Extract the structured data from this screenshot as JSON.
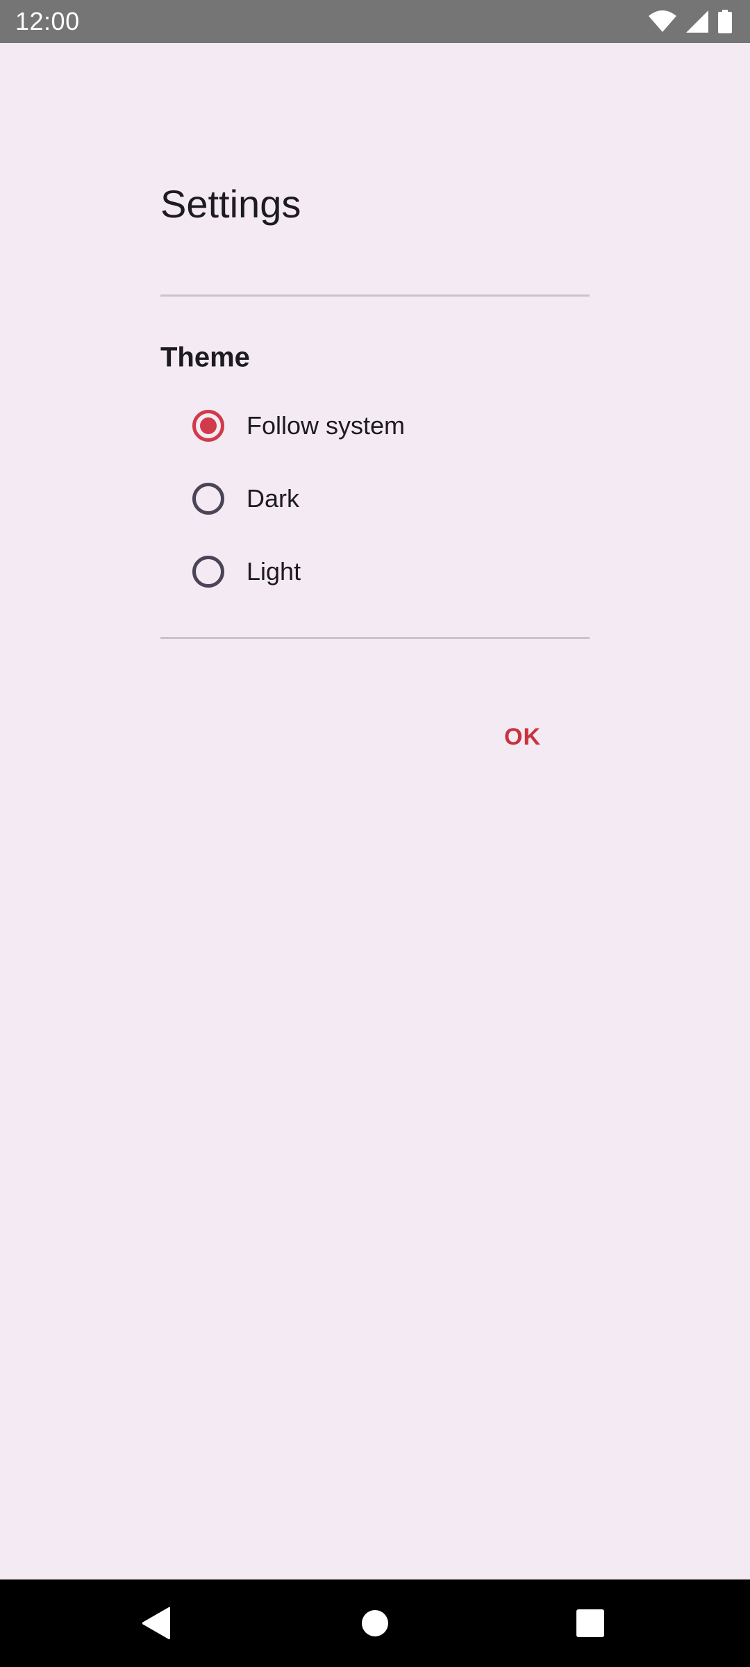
{
  "status_bar": {
    "time": "12:00",
    "icons": [
      "wifi-icon",
      "cellular-signal-icon",
      "battery-icon"
    ]
  },
  "dialog": {
    "title": "Settings",
    "section_label": "Theme",
    "options": [
      {
        "label": "Follow system",
        "selected": true
      },
      {
        "label": "Dark",
        "selected": false
      },
      {
        "label": "Light",
        "selected": false
      }
    ],
    "ok_label": "OK"
  },
  "nav_bar": {
    "icons": [
      "back-icon",
      "home-icon",
      "recents-icon"
    ]
  },
  "colors": {
    "background": "#f4eaf3",
    "accent": "#d03a4a",
    "status_bar": "#757575",
    "nav_bar": "#000000"
  }
}
